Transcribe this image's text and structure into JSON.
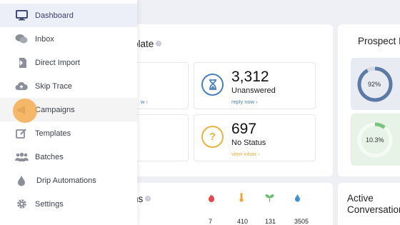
{
  "sidebar": {
    "items": [
      {
        "label": "Dashboard",
        "icon": "monitor-icon"
      },
      {
        "label": "Inbox",
        "icon": "chat-icon"
      },
      {
        "label": "Direct Import",
        "icon": "file-import-icon"
      },
      {
        "label": "Skip Trace",
        "icon": "cloud-upload-icon"
      },
      {
        "label": "Campaigns",
        "icon": "megaphone-icon"
      },
      {
        "label": "Templates",
        "icon": "edit-icon"
      },
      {
        "label": "Batches",
        "icon": "users-icon"
      },
      {
        "label": "Drip Automations",
        "icon": "drop-icon"
      },
      {
        "label": "Settings",
        "icon": "gear-icon"
      }
    ]
  },
  "template_section": {
    "title_fragment": "plate",
    "cards": [
      {
        "value": "",
        "label": "",
        "link": "w"
      },
      {
        "value": "3,312",
        "label": "Unanswered",
        "link": "reply now",
        "icon": "hourglass-icon"
      },
      {
        "value": "",
        "label": "rs",
        "link": "ers"
      },
      {
        "value": "697",
        "label": "No Status",
        "link": "view inbox",
        "icon": "question-icon"
      }
    ]
  },
  "prospect": {
    "title": "Prospect I",
    "rings": [
      {
        "value_text": "92%",
        "percent": 92,
        "color": "#5b7aa6"
      },
      {
        "value_text": "10.3%",
        "percent": 10.3,
        "color": "#7bc47f"
      }
    ]
  },
  "bottom_section": {
    "title_fragment": "ns",
    "icons": [
      "fire-icon",
      "thermometer-icon",
      "sprout-icon",
      "water-drop-icon"
    ],
    "values": [
      "7",
      "410",
      "131",
      "3505"
    ]
  },
  "active_conv": {
    "line1": "Active",
    "line2": "Conversation"
  },
  "colors": {
    "blue": "#4a7fc1",
    "yellow": "#e7b43a",
    "red_link": "#e05a5a"
  }
}
